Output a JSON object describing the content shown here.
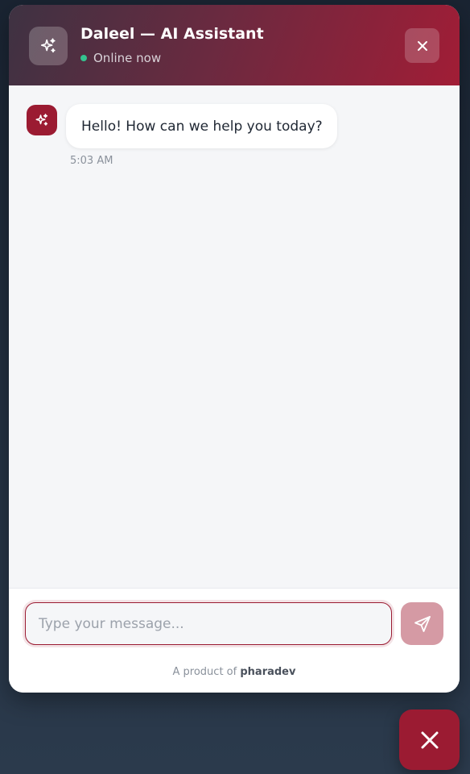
{
  "header": {
    "title": "Daleel — AI Assistant",
    "status": "Online now",
    "avatar_icon": "sparkles-icon",
    "close_icon": "close-icon"
  },
  "messages": [
    {
      "sender": "bot",
      "avatar_icon": "sparkles-icon",
      "text": "Hello! How can we help you today?",
      "time": "5:03 AM"
    }
  ],
  "composer": {
    "placeholder": "Type your message...",
    "value": "",
    "send_icon": "send-icon"
  },
  "footer": {
    "prefix": "A product of",
    "brand": "pharadev"
  },
  "launcher": {
    "icon": "close-icon"
  },
  "colors": {
    "accent": "#9b1b32",
    "status_online": "#34c38f",
    "send_disabled": "#d59aa4",
    "chat_background": "#f5f6f8"
  }
}
